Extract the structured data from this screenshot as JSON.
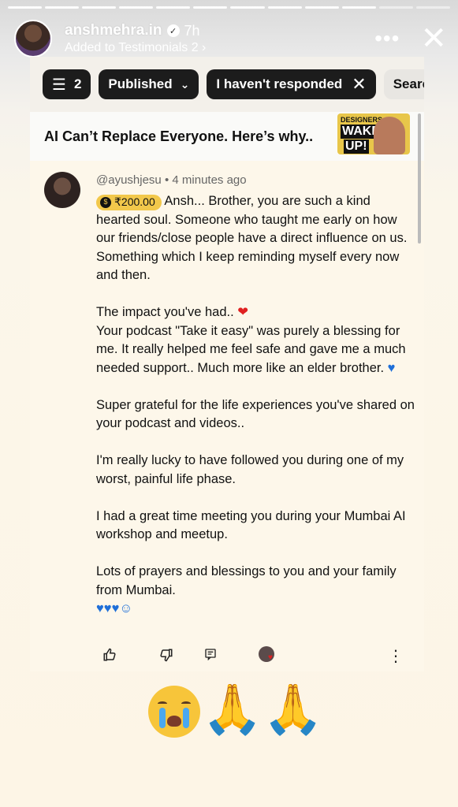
{
  "story": {
    "username": "anshmehra.in",
    "time": "7h",
    "subline_prefix": "Added to",
    "highlight": "Testimonials 2",
    "chevron": "›",
    "more_icon": "•••",
    "close_icon": "✕"
  },
  "filters": {
    "count": "2",
    "sliders_icon": "sliders-icon",
    "published": "Published",
    "caret": "⌄",
    "not_responded": "I haven't responded",
    "clear": "✕",
    "search": "Search"
  },
  "video": {
    "title": "AI Can’t Replace Everyone. Here’s why..",
    "thumb_line1": "DESIGNERS",
    "thumb_line2": "WAKE",
    "thumb_line3": "UP!"
  },
  "comment": {
    "handle": "@ayushjesu",
    "separator": "•",
    "time": "4 minutes ago",
    "super_amount": "₹200.00",
    "p1": "Ansh... Brother, you are such a kind hearted soul. Someone who taught me early on how our friends/close people have a direct influence on us. Something which I keep reminding myself every now and then.",
    "p2a": "The impact you've had..",
    "p2_heart": "❤",
    "p2b": "Your podcast \"Take it easy\" was purely a blessing for me. It really helped me feel safe and gave me a much needed support.. Much more like an elder brother.",
    "p2_blue": "♥",
    "p3": "Super grateful for the life experiences you've shared on your podcast and videos..",
    "p4": "I'm really lucky to have followed you during one of my worst, painful life phase.",
    "p5": "I had a great time  meeting you during your Mumbai AI workshop and meetup.",
    "p6": "Lots of prayers and blessings to you and your family from Mumbai.",
    "p6_emojis": "♥♥♥☺"
  },
  "actions": {
    "like_icon": "👍",
    "dislike_icon": "👎",
    "reply_icon": "▤",
    "more_icon": "⋮"
  },
  "sticker": {
    "pray": "🙏🙏"
  },
  "colors": {
    "chip_dark": "#1c1c1c",
    "super_badge": "#f2c84b",
    "card_bg": "#fdf7ea"
  }
}
